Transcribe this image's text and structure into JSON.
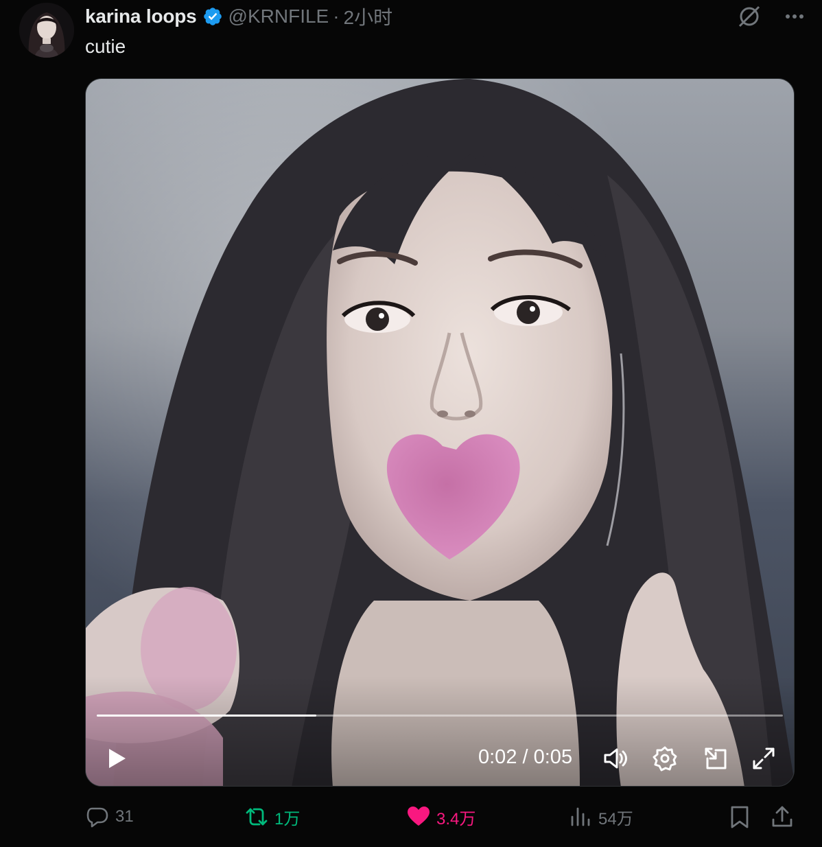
{
  "author": {
    "display_name": "karina loops",
    "handle": "@KRNFILE",
    "separator": "·",
    "time_ago": "2小时",
    "verified": true,
    "verified_color": "#1d9bf0"
  },
  "tweet": {
    "text": "cutie"
  },
  "video": {
    "current_time": "0:02",
    "time_separator": " / ",
    "duration": "0:05",
    "progress": 0.32
  },
  "actions": {
    "replies": "31",
    "retweets": "1万",
    "likes": "3.4万",
    "views": "54万",
    "retweet_color": "#00ba7c",
    "like_color": "#f91880",
    "muted_color": "#71767b"
  },
  "icons": {
    "grok": "grok-icon",
    "more": "more-icon",
    "play": "play-icon",
    "volume": "volume-icon",
    "settings": "gear-icon",
    "pip": "picture-in-picture-icon",
    "fullscreen": "fullscreen-icon",
    "reply": "reply-icon",
    "retweet": "retweet-icon",
    "like": "heart-icon",
    "views": "views-icon",
    "bookmark": "bookmark-icon",
    "share": "share-icon"
  }
}
